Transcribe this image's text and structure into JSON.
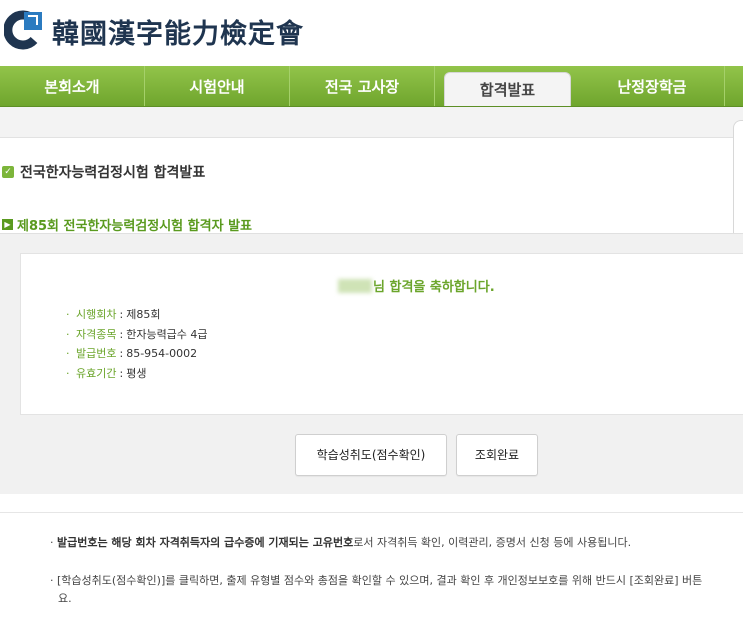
{
  "header": {
    "logo_text": "韓國漢字能力檢定會"
  },
  "nav": {
    "items": [
      {
        "label": "본회소개"
      },
      {
        "label": "시험안내"
      },
      {
        "label": "전국 고사장"
      },
      {
        "label": "합격발표"
      },
      {
        "label": "난정장학금"
      }
    ],
    "active": "합격발표"
  },
  "page": {
    "title": "전국한자능력검정시험 합격발표",
    "subtitle": "제85회 전국한자능력검정시험 합격자 발표"
  },
  "result": {
    "congrats_suffix": "님 합격을 축하합니다.",
    "info": [
      {
        "key": "시행회차",
        "value": "제85회"
      },
      {
        "key": "자격종목",
        "value": "한자능력급수 4급"
      },
      {
        "key": "발급번호",
        "value": "85-954-0002"
      },
      {
        "key": "유효기간",
        "value": "평생"
      }
    ]
  },
  "buttons": {
    "score_check": "학습성취도(점수확인)",
    "done": "조회완료"
  },
  "notes": {
    "note1_bold": "발급번호는 해당 회차 자격취득자의 급수증에 기재되는 고유번호",
    "note1_rest": "로서 자격취득 확인, 이력관리, 증명서 신청 등에 사용됩니다.",
    "note2": "[학습성취도(점수확인)]를 클릭하면, 출제 유형별 점수와 총점을 확인할 수 있으며, 결과 확인 후 개인정보보호를 위해 반드시 [조회완료] 버튼",
    "note2_cont": "요."
  },
  "colors": {
    "nav_green": "#7cb53a",
    "accent_green": "#6ba52b",
    "logo_navy": "#1f3550"
  }
}
